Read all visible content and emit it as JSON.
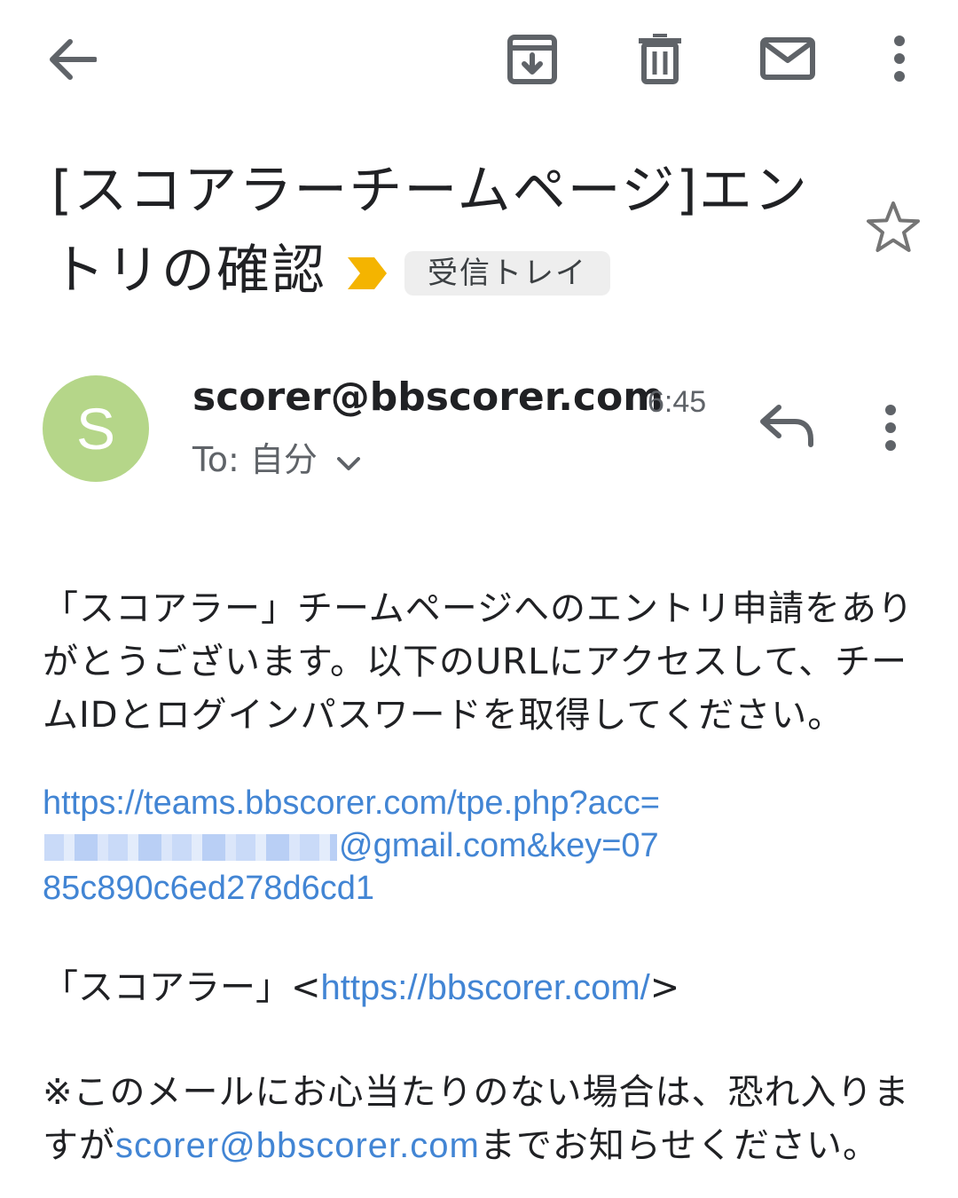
{
  "colors": {
    "accent_link": "#4285d4",
    "avatar_bg": "#b5d689",
    "important_marker": "#f4b400",
    "icon_gray": "#5f6368"
  },
  "toolbar": {
    "back_icon": "arrow-left-icon",
    "archive_icon": "archive-icon",
    "delete_icon": "trash-icon",
    "mark_unread_icon": "envelope-icon",
    "more_icon": "more-vert-icon"
  },
  "email": {
    "subject": "[スコアラーチームページ]エントリの確認",
    "label": "受信トレイ",
    "starred": false,
    "sender_initial": "S",
    "sender": "scorer@bbscorer.com",
    "time": "6:45",
    "to_line": "To: 自分",
    "body": {
      "p1": "「スコアラー」チームページへのエントリ申請をありがとうございます。以下のURLにアクセスして、チームIDとログインパスワードを取得してください。",
      "url_part1": "https://teams.bbscorer.com/tpe.php?acc=",
      "url_part2": "@gmail.com&key=0785c890c6ed278d6cd1",
      "p3_prefix": "「スコアラー」<",
      "p3_link": "https://bbscorer.com/",
      "p3_suffix": ">",
      "p4_prefix": "※このメールにお心当たりのない場合は、恐れ入りますが",
      "p4_link": "scorer@bbscorer.com",
      "p4_suffix": "までお知らせください。"
    }
  }
}
